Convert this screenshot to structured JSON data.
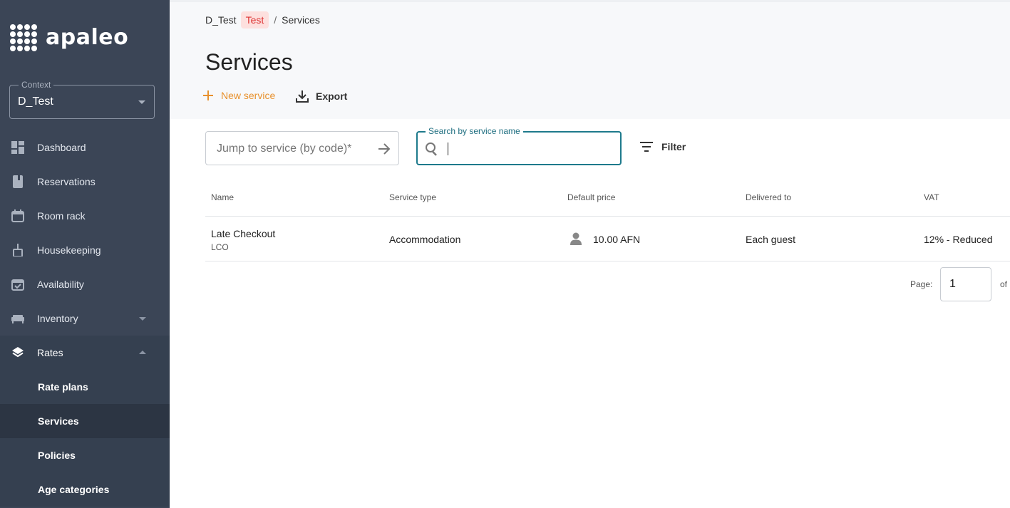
{
  "brand": {
    "name": "apaleo"
  },
  "context": {
    "legend": "Context",
    "value": "D_Test"
  },
  "nav": {
    "dashboard": "Dashboard",
    "reservations": "Reservations",
    "room_rack": "Room rack",
    "housekeeping": "Housekeeping",
    "availability": "Availability",
    "inventory": "Inventory",
    "rates": "Rates",
    "rate_plans": "Rate plans",
    "services": "Services",
    "policies": "Policies",
    "age_categories": "Age categories"
  },
  "breadcrumb": {
    "root": "D_Test",
    "badge": "Test",
    "separator": "/",
    "current": "Services"
  },
  "page": {
    "title": "Services"
  },
  "actions": {
    "new_service": "New service",
    "export": "Export"
  },
  "jump": {
    "placeholder": "Jump to service (by code)*"
  },
  "search": {
    "legend": "Search by service name",
    "value": ""
  },
  "filter": {
    "label": "Filter"
  },
  "table": {
    "headers": {
      "name": "Name",
      "service_type": "Service type",
      "default_price": "Default price",
      "delivered_to": "Delivered to",
      "vat": "VAT"
    },
    "rows": [
      {
        "name": "Late Checkout",
        "code": "LCO",
        "service_type": "Accommodation",
        "price": "10.00 AFN",
        "delivered_to": "Each guest",
        "vat": "12% - Reduced"
      }
    ]
  },
  "pagination": {
    "label": "Page:",
    "value": "1",
    "of": "of"
  },
  "colors": {
    "sidebar": "#3b4556",
    "accent": "#e8912d",
    "focus": "#1e7a8c",
    "badge_bg": "#fde0de",
    "badge_text": "#d33333"
  }
}
